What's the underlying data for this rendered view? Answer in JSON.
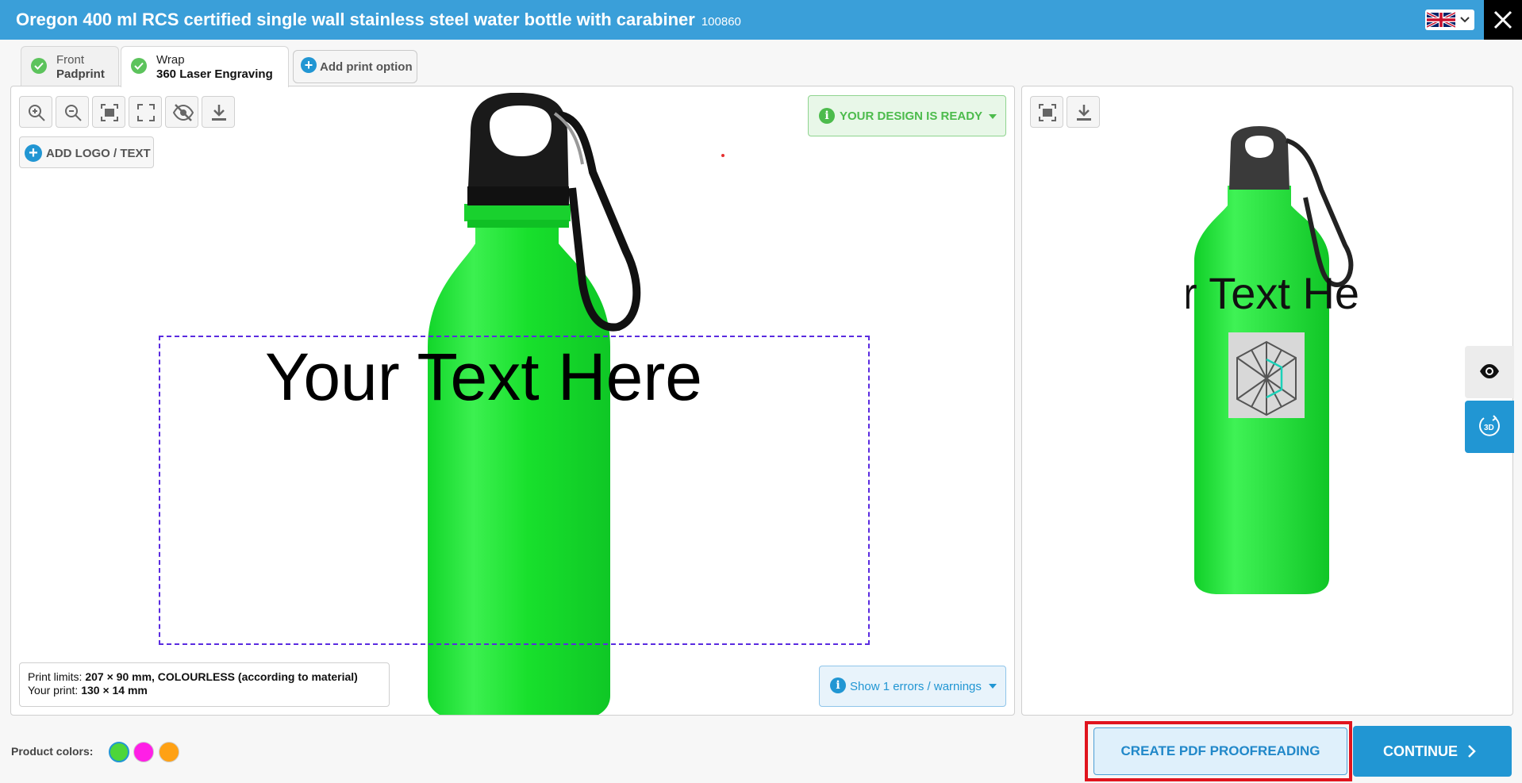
{
  "header": {
    "title": "Oregon 400 ml RCS certified single wall stainless steel water bottle with carabiner",
    "product_code": "100860",
    "language_flag": "uk-flag-icon",
    "close_icon": "close-icon"
  },
  "tabs": [
    {
      "top_label": "Front",
      "bottom_label": "Padprint",
      "status": "done",
      "active": false
    },
    {
      "top_label": "Wrap",
      "bottom_label": "360 Laser Engraving",
      "status": "done",
      "active": true
    }
  ],
  "add_print_option": {
    "label": "Add print option",
    "icon": "plus-circle-icon"
  },
  "editor": {
    "toolbar": [
      {
        "name": "zoom-in-icon"
      },
      {
        "name": "zoom-out-icon"
      },
      {
        "name": "fit-screen-icon"
      },
      {
        "name": "fullscreen-icon"
      },
      {
        "name": "hide-icon"
      },
      {
        "name": "download-icon"
      }
    ],
    "add_logo_label": "ADD LOGO / TEXT",
    "design_status": "YOUR DESIGN IS READY",
    "print_text": "Your Text Here",
    "print_limits_label": "Print limits:",
    "print_limits_value": "207 × 90 mm, COLOURLESS (according to material)",
    "your_print_label": "Your print:",
    "your_print_value": "130 × 14 mm",
    "errors_label": "Show 1 errors / warnings"
  },
  "preview": {
    "toolbar": [
      {
        "name": "fit-screen-icon"
      },
      {
        "name": "download-icon"
      }
    ],
    "preview_text": "r Text He",
    "side_buttons": [
      {
        "name": "eye-icon",
        "active": false
      },
      {
        "name": "3d-rotate-icon",
        "label": "3D",
        "active": true
      }
    ]
  },
  "footer": {
    "product_colors_label": "Product colors:",
    "product_colors": [
      {
        "name": "green",
        "hex": "#4dd63a",
        "selected": true
      },
      {
        "name": "magenta",
        "hex": "#ff1fe6",
        "selected": false
      },
      {
        "name": "orange",
        "hex": "#ffa114",
        "selected": false
      }
    ],
    "pdf_button_label": "CREATE PDF PROOFREADING",
    "continue_label": "CONTINUE"
  },
  "colors": {
    "header_bg": "#3a9fd9",
    "accent_blue": "#2196d3",
    "success_green": "#4cbb4c",
    "bottle_green": "#1fe02a",
    "print_area_border": "#5a2be0",
    "highlight_red": "#e0141e"
  }
}
